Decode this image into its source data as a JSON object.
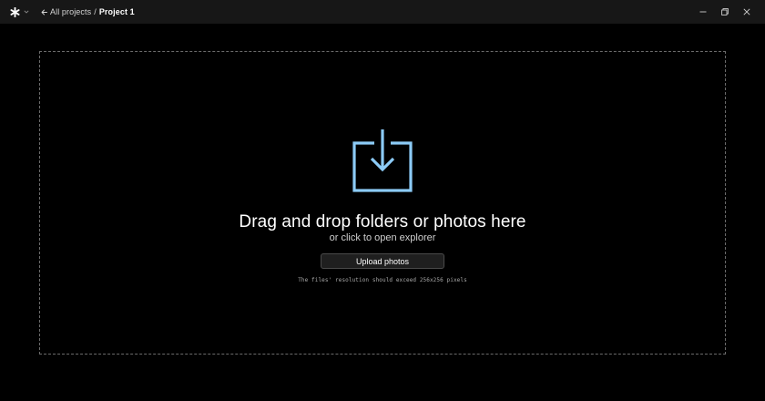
{
  "app": {
    "logo_icon": "asterisk-logo-icon",
    "menu_icon": "chevron-down-icon"
  },
  "breadcrumb": {
    "back_icon": "arrow-left-icon",
    "parent": "All projects",
    "separator": "/",
    "current": "Project 1"
  },
  "window_controls": {
    "minimize_icon": "minimize-icon",
    "restore_icon": "restore-icon",
    "close_icon": "close-icon"
  },
  "dropzone": {
    "icon": "upload-tray-icon",
    "title": "Drag and drop folders or photos here",
    "subtitle": "or click to open explorer",
    "button_label": "Upload photos",
    "note": "The files' resolution should exceed 256x256 pixels"
  },
  "colors": {
    "background": "#000000",
    "titlebar": "#171717",
    "accent_icon": "#8ccbf7",
    "dashed_border": "#6b6b6b",
    "button_bg": "#1f1f1f"
  }
}
